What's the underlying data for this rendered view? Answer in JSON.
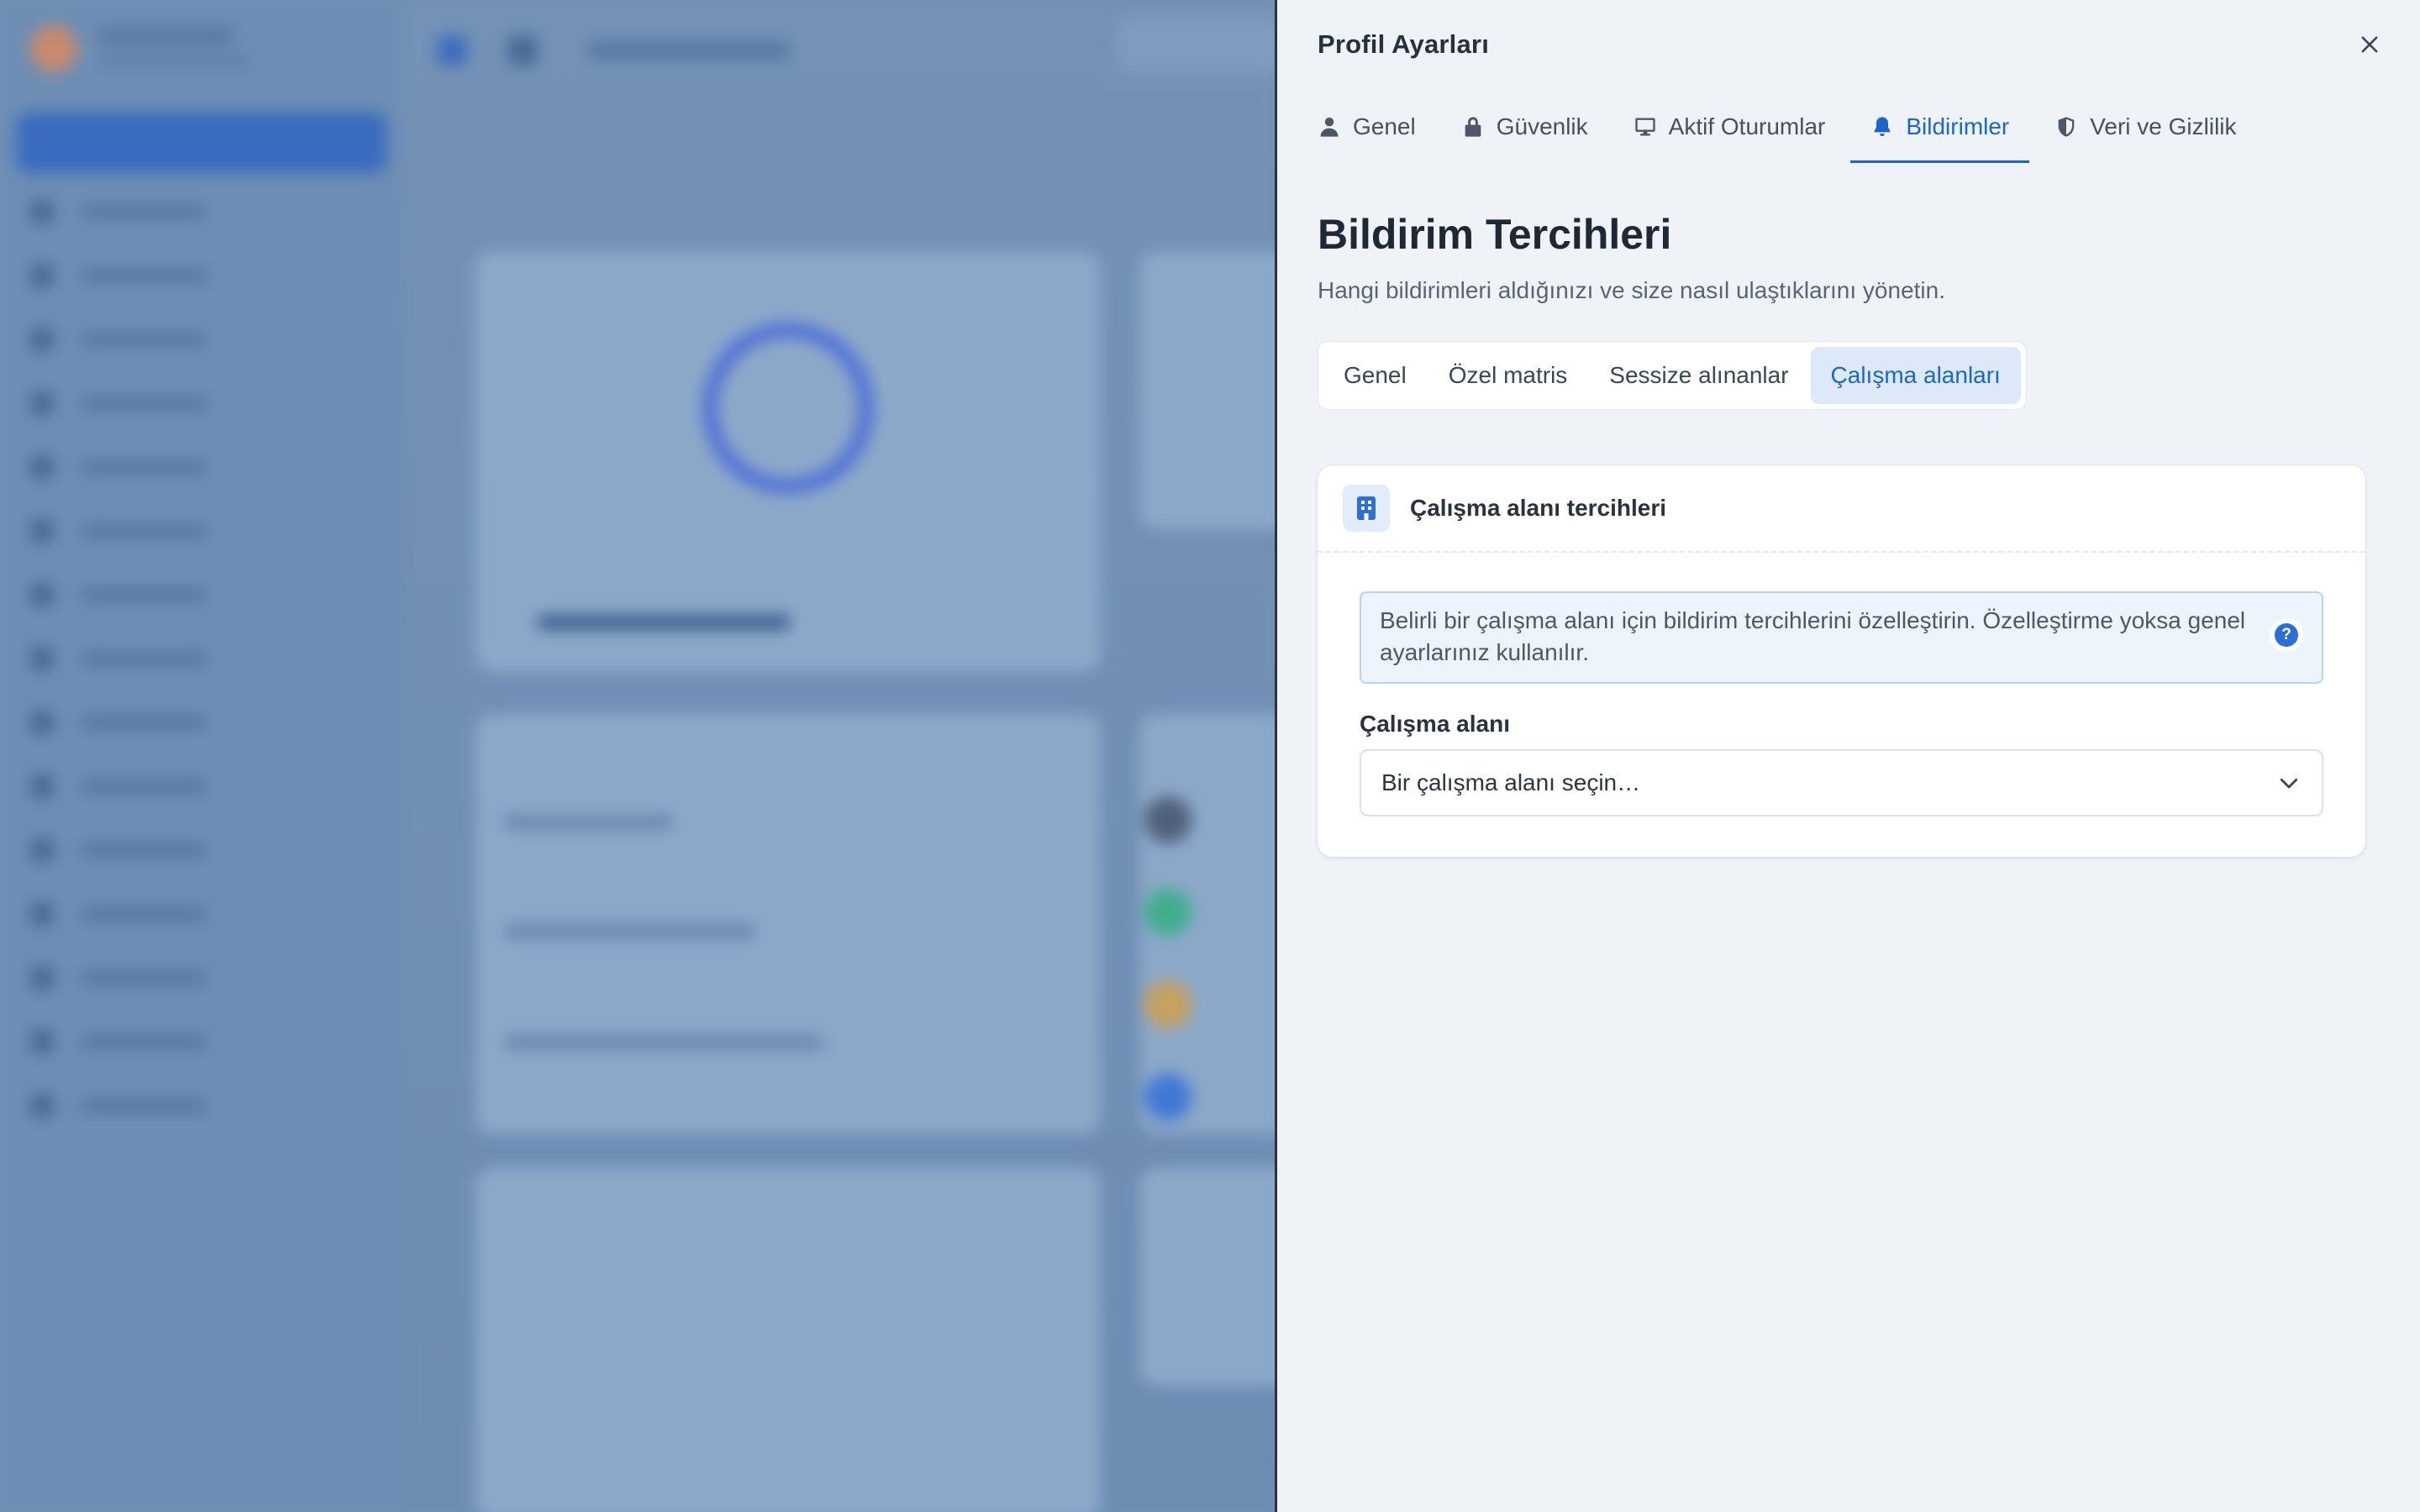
{
  "panel": {
    "title": "Profil Ayarları",
    "close_icon": "close-icon"
  },
  "main_tabs": [
    {
      "label": "Genel",
      "icon": "user-icon",
      "active": false
    },
    {
      "label": "Güvenlik",
      "icon": "lock-icon",
      "active": false
    },
    {
      "label": "Aktif Oturumlar",
      "icon": "monitor-icon",
      "active": false
    },
    {
      "label": "Bildirimler",
      "icon": "bell-icon",
      "active": true
    },
    {
      "label": "Veri ve Gizlilik",
      "icon": "shield-icon",
      "active": false
    }
  ],
  "section": {
    "title": "Bildirim Tercihleri",
    "description": "Hangi bildirimleri aldığınızı ve size nasıl ulaştıklarını yönetin."
  },
  "sub_tabs": [
    {
      "label": "Genel",
      "active": false
    },
    {
      "label": "Özel matris",
      "active": false
    },
    {
      "label": "Sessize alınanlar",
      "active": false
    },
    {
      "label": "Çalışma alanları",
      "active": true
    }
  ],
  "workspace_card": {
    "title": "Çalışma alanı tercihleri",
    "info_text": "Belirli bir çalışma alanı için bildirim tercihlerini özelleştirin. Özelleştirme yoksa genel ayarlarınız kullanılır.",
    "help_icon_glyph": "?",
    "field_label": "Çalışma alanı",
    "select_placeholder": "Bir çalışma alanı seçin…"
  },
  "colors": {
    "accent": "#1b66c9",
    "panel_bg": "#eff2f7",
    "backdrop": "#6f8fb4"
  }
}
